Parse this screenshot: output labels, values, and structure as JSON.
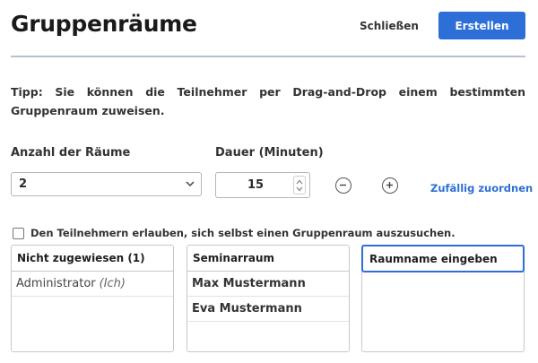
{
  "dialog": {
    "title": "Gruppenräume",
    "close_label": "Schließen",
    "create_label": "Erstellen"
  },
  "tip": "Tipp: Sie können die Teilnehmer per Drag-and-Drop einem bestimmten Gruppenraum zuweisen.",
  "rooms": {
    "label": "Anzahl der Räume",
    "value": "2"
  },
  "duration": {
    "label": "Dauer (Minuten)",
    "value": "15"
  },
  "random_assign_label": "Zufällig zuordnen",
  "self_select": {
    "label": "Den Teilnehmern erlauben, sich selbst einen Gruppenraum auszusuchen.",
    "checked": false
  },
  "columns": [
    {
      "header": "Nicht zugewiesen (1)",
      "participants": [
        {
          "name": "Administrator",
          "suffix": "(Ich)"
        }
      ]
    },
    {
      "header": "Seminarraum",
      "participants": [
        {
          "name": "Max Mustermann"
        },
        {
          "name": "Eva Mustermann"
        }
      ]
    },
    {
      "header": "Raumname eingeben",
      "participants": []
    }
  ],
  "colors": {
    "accent": "#2d6fd6",
    "divider": "#b7c1cc"
  },
  "icons": {
    "rooms_select": "chevron-down-icon",
    "duration_spinner": "spinner-arrows-icon",
    "decrease": "minus-circle-icon",
    "increase": "plus-circle-icon"
  }
}
